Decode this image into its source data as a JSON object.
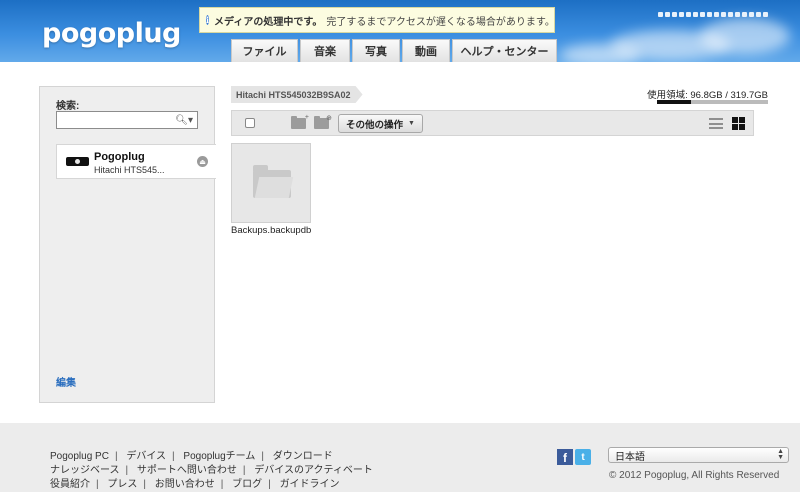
{
  "header": {
    "logo": "pogoplug",
    "notice_bold": "メディアの処理中です。",
    "notice_rest": "完了するまでアクセスが遅くなる場合があります。"
  },
  "nav": {
    "tabs": [
      {
        "label": "ファイル",
        "active": true
      },
      {
        "label": "音楽",
        "active": false
      },
      {
        "label": "写真",
        "active": false
      },
      {
        "label": "動画",
        "active": false
      },
      {
        "label": "ヘルプ・センター",
        "active": false
      }
    ]
  },
  "sidebar": {
    "search_label": "検索:",
    "search_placeholder": "",
    "device_name": "Pogoplug",
    "device_sub": "Hitachi HTS545...",
    "edit_link": "編集"
  },
  "main": {
    "breadcrumb": "Hitachi HTS545032B9SA02",
    "storage_text": "使用領域: 96.8GB / 319.7GB",
    "storage_fraction": 0.303,
    "actions_label": "その他の操作",
    "files": [
      {
        "name": "Backups.backupdb"
      }
    ]
  },
  "footer": {
    "row1": [
      "Pogoplug PC",
      "デバイス",
      "Pogoplugチーム",
      "ダウンロード"
    ],
    "row2": [
      "ナレッジベース",
      "サポートへ問い合わせ",
      "デバイスのアクティベート"
    ],
    "row3": [
      "役員紹介",
      "プレス",
      "お問い合わせ",
      "ブログ",
      "ガイドライン"
    ],
    "language": "日本語",
    "copyright": "© 2012 Pogoplug, All Rights Reserved"
  },
  "colors": {
    "header_blue": "#2a7fd4",
    "active_tab": "#1f1f1f",
    "link_blue": "#2c6fbf",
    "notice_bg": "#fcfce0"
  }
}
